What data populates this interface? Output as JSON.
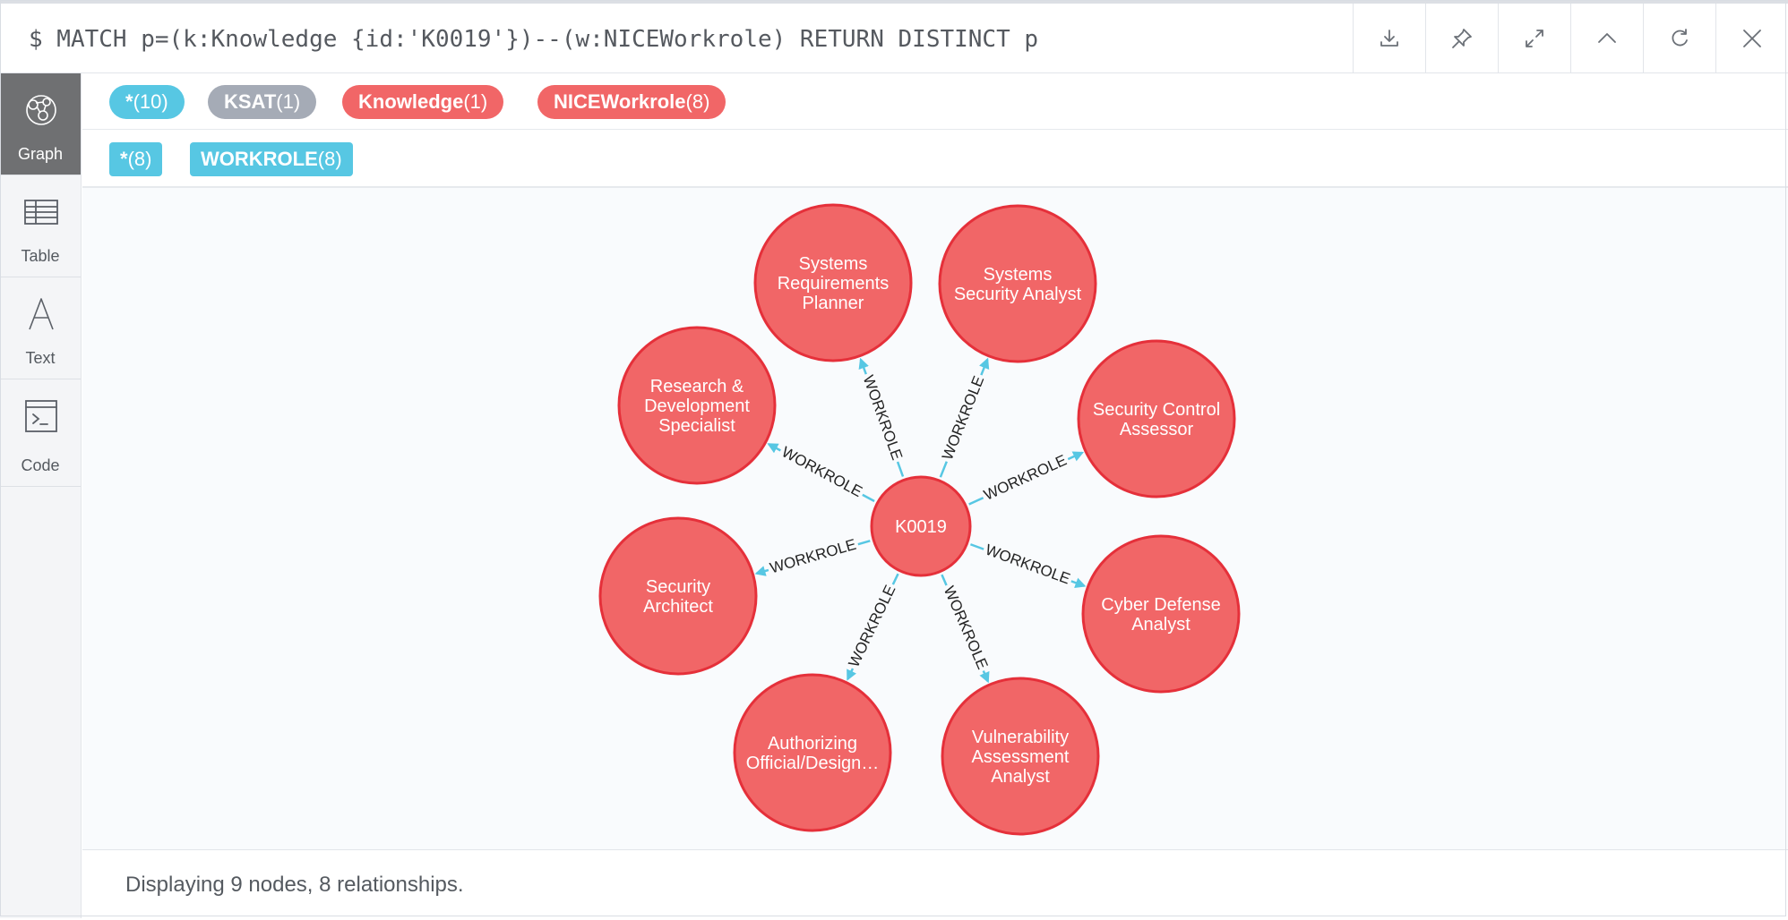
{
  "header": {
    "query": "$ MATCH p=(k:Knowledge {id:'K0019'})--(w:NICEWorkrole) RETURN DISTINCT p",
    "toolbar": [
      {
        "name": "download-icon"
      },
      {
        "name": "pin-icon"
      },
      {
        "name": "expand-icon"
      },
      {
        "name": "collapse-up-icon"
      },
      {
        "name": "rerun-icon"
      },
      {
        "name": "close-icon"
      }
    ]
  },
  "sidebar": {
    "items": [
      {
        "label": "Graph",
        "icon": "graph-icon",
        "active": true
      },
      {
        "label": "Table",
        "icon": "table-icon",
        "active": false
      },
      {
        "label": "Text",
        "icon": "text-icon",
        "active": false
      },
      {
        "label": "Code",
        "icon": "code-icon",
        "active": false
      }
    ]
  },
  "labels": [
    {
      "name": "*",
      "count": "(10)",
      "color": "#57c7e3"
    },
    {
      "name": "KSAT",
      "count": "(1)",
      "color": "#a5abb6"
    },
    {
      "name": "Knowledge",
      "count": "(1)",
      "color": "#f16667"
    },
    {
      "name": "NICEWorkrole",
      "count": "(8)",
      "color": "#f16667"
    }
  ],
  "relationship_types": [
    {
      "name": "*",
      "count": "(8)",
      "color": "#57c7e3"
    },
    {
      "name": "WORKROLE",
      "count": "(8)",
      "color": "#57c7e3"
    }
  ],
  "graph": {
    "center": {
      "lines": [
        "K0019"
      ]
    },
    "relationship_label": "WORKROLE",
    "nodes": [
      {
        "lines": [
          "Systems",
          "Requirements",
          "Planner"
        ]
      },
      {
        "lines": [
          "Systems",
          "Security Analyst"
        ]
      },
      {
        "lines": [
          "Security Control",
          "Assessor"
        ]
      },
      {
        "lines": [
          "Cyber Defense",
          "Analyst"
        ]
      },
      {
        "lines": [
          "Vulnerability",
          "Assessment",
          "Analyst"
        ]
      },
      {
        "lines": [
          "Authorizing",
          "Official/Design…"
        ]
      },
      {
        "lines": [
          "Security",
          "Architect"
        ]
      },
      {
        "lines": [
          "Research &",
          "Development",
          "Specialist"
        ]
      }
    ]
  },
  "status": {
    "text": "Displaying 9 nodes, 8 relationships."
  }
}
